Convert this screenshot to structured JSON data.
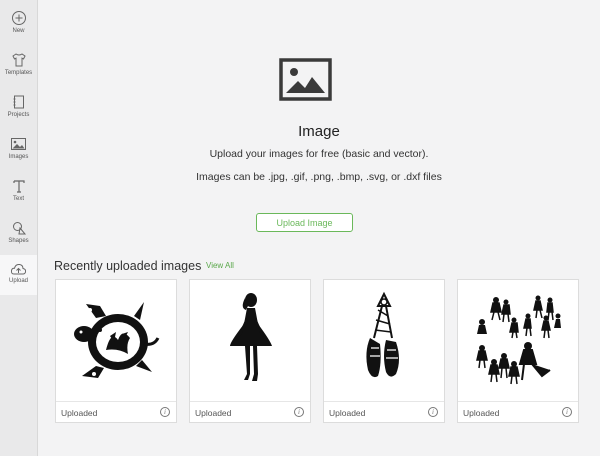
{
  "sidebar": {
    "items": [
      {
        "label": "New",
        "icon": "plus-circle-icon"
      },
      {
        "label": "Templates",
        "icon": "tshirt-icon"
      },
      {
        "label": "Projects",
        "icon": "notebook-icon"
      },
      {
        "label": "Images",
        "icon": "image-icon"
      },
      {
        "label": "Text",
        "icon": "text-t-icon"
      },
      {
        "label": "Shapes",
        "icon": "shapes-icon"
      },
      {
        "label": "Upload",
        "icon": "cloud-upload-icon"
      }
    ],
    "active": "Upload"
  },
  "hero": {
    "icon": "image-icon",
    "title": "Image",
    "line1": "Upload your images for free (basic and vector).",
    "line2": "Images can be .jpg, .gif, .png, .bmp, .svg, or .dxf files",
    "button": "Upload Image"
  },
  "recent": {
    "title": "Recently uploaded images",
    "view_all": "View All",
    "cards": [
      {
        "caption": "Uploaded",
        "thumb": "turtle-silhouette"
      },
      {
        "caption": "Uploaded",
        "thumb": "irish-dancer-silhouette"
      },
      {
        "caption": "Uploaded",
        "thumb": "dance-shoes-silhouette"
      },
      {
        "caption": "Uploaded",
        "thumb": "dancers-group-silhouette"
      }
    ],
    "info_glyph": "i"
  },
  "colors": {
    "accent": "#6ab85a",
    "sidebar": "#e9e9ea",
    "background": "#f3f3f4"
  }
}
